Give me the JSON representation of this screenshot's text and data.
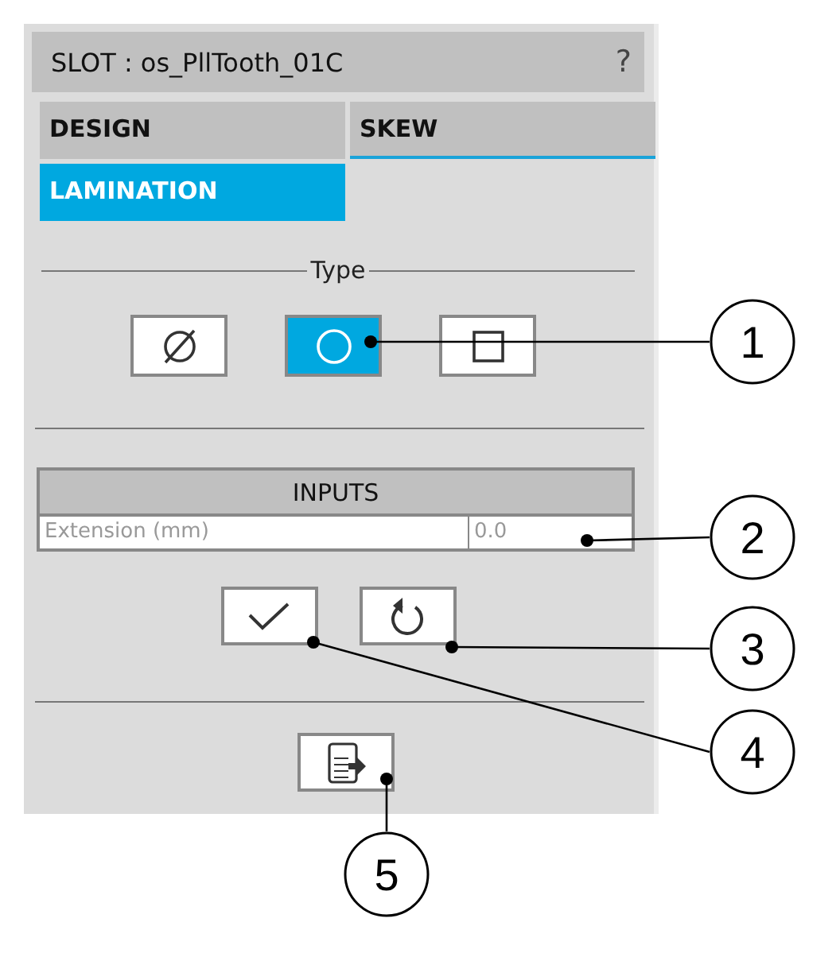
{
  "window": {
    "title": "SLOT : os_PllTooth_01C",
    "help": "?"
  },
  "tabs": [
    {
      "label": "DESIGN",
      "selected": false,
      "underline": false
    },
    {
      "label": "SKEW",
      "selected": false,
      "underline": true
    },
    {
      "label": "LAMINATION",
      "selected": true,
      "underline": false
    }
  ],
  "type_group": {
    "label": "Type",
    "options": [
      {
        "kind": "none",
        "selected": false
      },
      {
        "kind": "circle",
        "selected": true
      },
      {
        "kind": "rectangle",
        "selected": false
      }
    ]
  },
  "inputs": {
    "title": "INPUTS",
    "rows": [
      {
        "label": "Extension (mm)",
        "value": "0.0"
      }
    ]
  },
  "callouts": [
    {
      "label": "1"
    },
    {
      "label": "2"
    },
    {
      "label": "3"
    },
    {
      "label": "4"
    },
    {
      "label": "5"
    }
  ]
}
